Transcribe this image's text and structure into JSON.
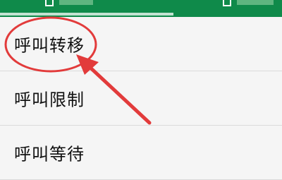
{
  "tabs": {
    "active_underline_color": "#ffffff",
    "bar_color": "#0f8a4a"
  },
  "settings_list": {
    "items": [
      {
        "label": "呼叫转移"
      },
      {
        "label": "呼叫限制"
      },
      {
        "label": "呼叫等待"
      }
    ]
  },
  "annotation": {
    "color": "#e23b3b",
    "icon": "highlight-ellipse-and-arrow"
  }
}
